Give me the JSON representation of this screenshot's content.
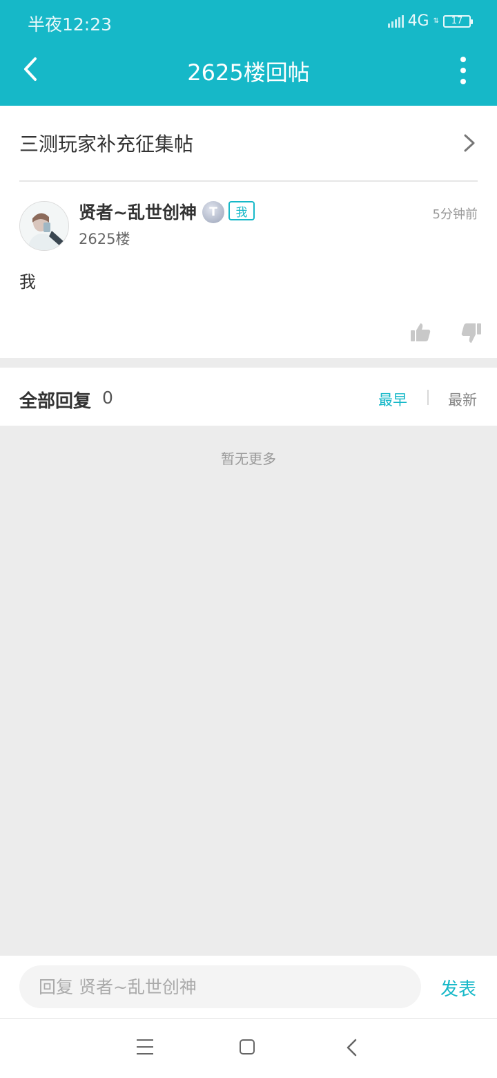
{
  "status_bar": {
    "time": "半夜12:23",
    "network": "4G",
    "battery": "17"
  },
  "nav": {
    "title": "2625楼回帖"
  },
  "topic": {
    "title": "三测玩家补充征集帖"
  },
  "post": {
    "username": "贤者~乱世创神",
    "level_badge": "T",
    "owner_badge": "我",
    "time": "5分钟前",
    "floor": "2625楼",
    "content": "我"
  },
  "replies": {
    "title": "全部回复",
    "count": "0",
    "sort_earliest": "最早",
    "sort_latest": "最新",
    "empty_text": "暂无更多"
  },
  "reply_bar": {
    "placeholder": "回复 贤者~乱世创神",
    "send_label": "发表"
  },
  "colors": {
    "accent": "#16b8c8",
    "background_gray": "#ececec"
  },
  "icons": {
    "back": "back-arrow-icon",
    "more": "more-vertical-icon",
    "topic_chevron": "chevron-right-icon",
    "like": "thumbs-up-icon",
    "dislike": "thumbs-down-icon"
  }
}
